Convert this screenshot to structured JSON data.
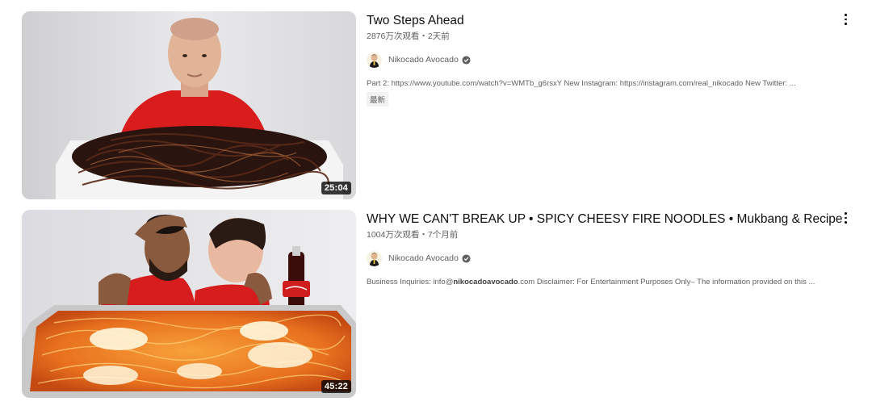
{
  "videos": [
    {
      "title": "Two Steps Ahead",
      "meta": "2876万次观看・2天前",
      "channel": "Nikocado Avocado",
      "description": "Part 2: https://www.youtube.com/watch?v=WMTb_g6rsxY New Instagram: https://instagram.com/real_nikocado New Twitter: ...",
      "badge": "最新",
      "duration": "25:04",
      "thumbnail_icon": "video-thumbnail-noodles",
      "avatar_icon": "channel-avatar",
      "verified_icon": "verified-check-icon",
      "menu_icon": "more-vert-icon"
    },
    {
      "title": "WHY WE CAN'T BREAK UP • SPICY CHEESY FIRE NOODLES • Mukbang & Recipe",
      "meta": "1004万次观看・7个月前",
      "channel": "Nikocado Avocado",
      "description_pre": "Business Inquiries: info@",
      "description_bold": "nikocadoavocado",
      "description_post": ".com Disclaimer: For Entertainment Purposes Only– The information provided on this ...",
      "duration": "45:22",
      "thumbnail_icon": "video-thumbnail-fire-noodles",
      "avatar_icon": "channel-avatar",
      "verified_icon": "verified-check-icon",
      "menu_icon": "more-vert-icon"
    }
  ],
  "colors": {
    "title": "#0f0f0f",
    "secondary_text": "#606060",
    "badge_bg": "#f2f2f2",
    "duration_bg": "#000000"
  }
}
